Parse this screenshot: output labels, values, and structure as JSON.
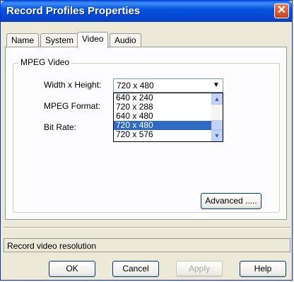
{
  "window": {
    "title": "Record Profiles Properties",
    "close_glyph": "✕"
  },
  "tabs": [
    {
      "label": "Name",
      "active": false
    },
    {
      "label": "System",
      "active": false
    },
    {
      "label": "Video",
      "active": true
    },
    {
      "label": "Audio",
      "active": false
    }
  ],
  "group": {
    "label": "MPEG Video"
  },
  "fields": {
    "width_height_label": "Width x Height:",
    "mpeg_format_label": "MPEG Format:",
    "bit_rate_label": "Bit Rate:"
  },
  "combo": {
    "value": "720 x 480",
    "options": [
      "640 x 240",
      "720 x 288",
      "640 x 480",
      "720 x 480",
      "720 x 576"
    ],
    "selected": "720 x 480"
  },
  "buttons": {
    "advanced": "Advanced .....",
    "ok": "OK",
    "cancel": "Cancel",
    "apply": "Apply",
    "help": "Help"
  },
  "status": {
    "text": "Record video resolution"
  },
  "icons": {
    "dropdown_arrow": "▼",
    "scroll_up": "▲",
    "scroll_down": "▼"
  },
  "colors": {
    "titlebar": "#0553df",
    "selection": "#316ac5",
    "close_button": "#c8431f"
  }
}
